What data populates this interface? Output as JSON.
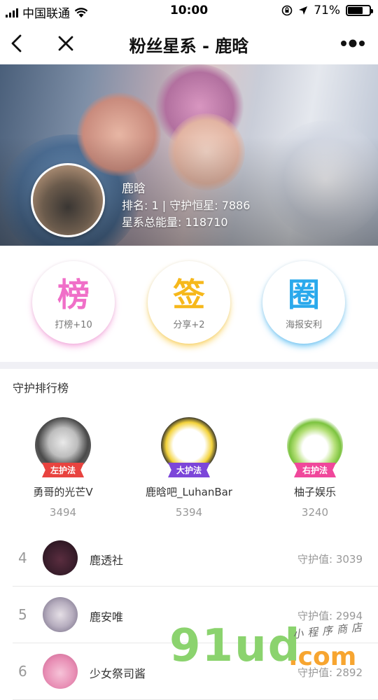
{
  "status_bar": {
    "carrier": "中国联通",
    "time": "10:00",
    "battery": "71%",
    "battery_level": 0.71
  },
  "navbar": {
    "title": "粉丝星系 - 鹿晗"
  },
  "hero": {
    "name": "鹿晗",
    "rank_line": "排名: 1 | 守护恒星: 7886",
    "energy_line": "星系总能量: 118710"
  },
  "actions": [
    {
      "glyph": "榜",
      "label": "打榜+10",
      "color": "#f06fc8"
    },
    {
      "glyph": "签",
      "label": "分享+2",
      "color": "#f6b81b"
    },
    {
      "glyph": "圈",
      "label": "海报安利",
      "color": "#2aa9ec"
    }
  ],
  "ranking": {
    "title": "守护排行榜",
    "top3": [
      {
        "name": "勇哥的光芒V",
        "value": "3494",
        "badge": "左护法",
        "badge_color": "#e8433f"
      },
      {
        "name": "鹿晗吧_LuhanBar",
        "value": "5394",
        "badge": "大护法",
        "badge_color": "#7c46d9"
      },
      {
        "name": "柚子娱乐",
        "value": "3240",
        "badge": "右护法",
        "badge_color": "#f0479b"
      }
    ],
    "list": [
      {
        "rank": "4",
        "name": "鹿透社",
        "value": "守护值: 3039"
      },
      {
        "rank": "5",
        "name": "鹿安唯",
        "value": "守护值: 2994"
      },
      {
        "rank": "6",
        "name": "少女祭司酱",
        "value": "守护值: 2892"
      }
    ]
  },
  "watermark": {
    "brand": "91ud",
    "tld": ".com",
    "tagline": "小程序商店"
  }
}
